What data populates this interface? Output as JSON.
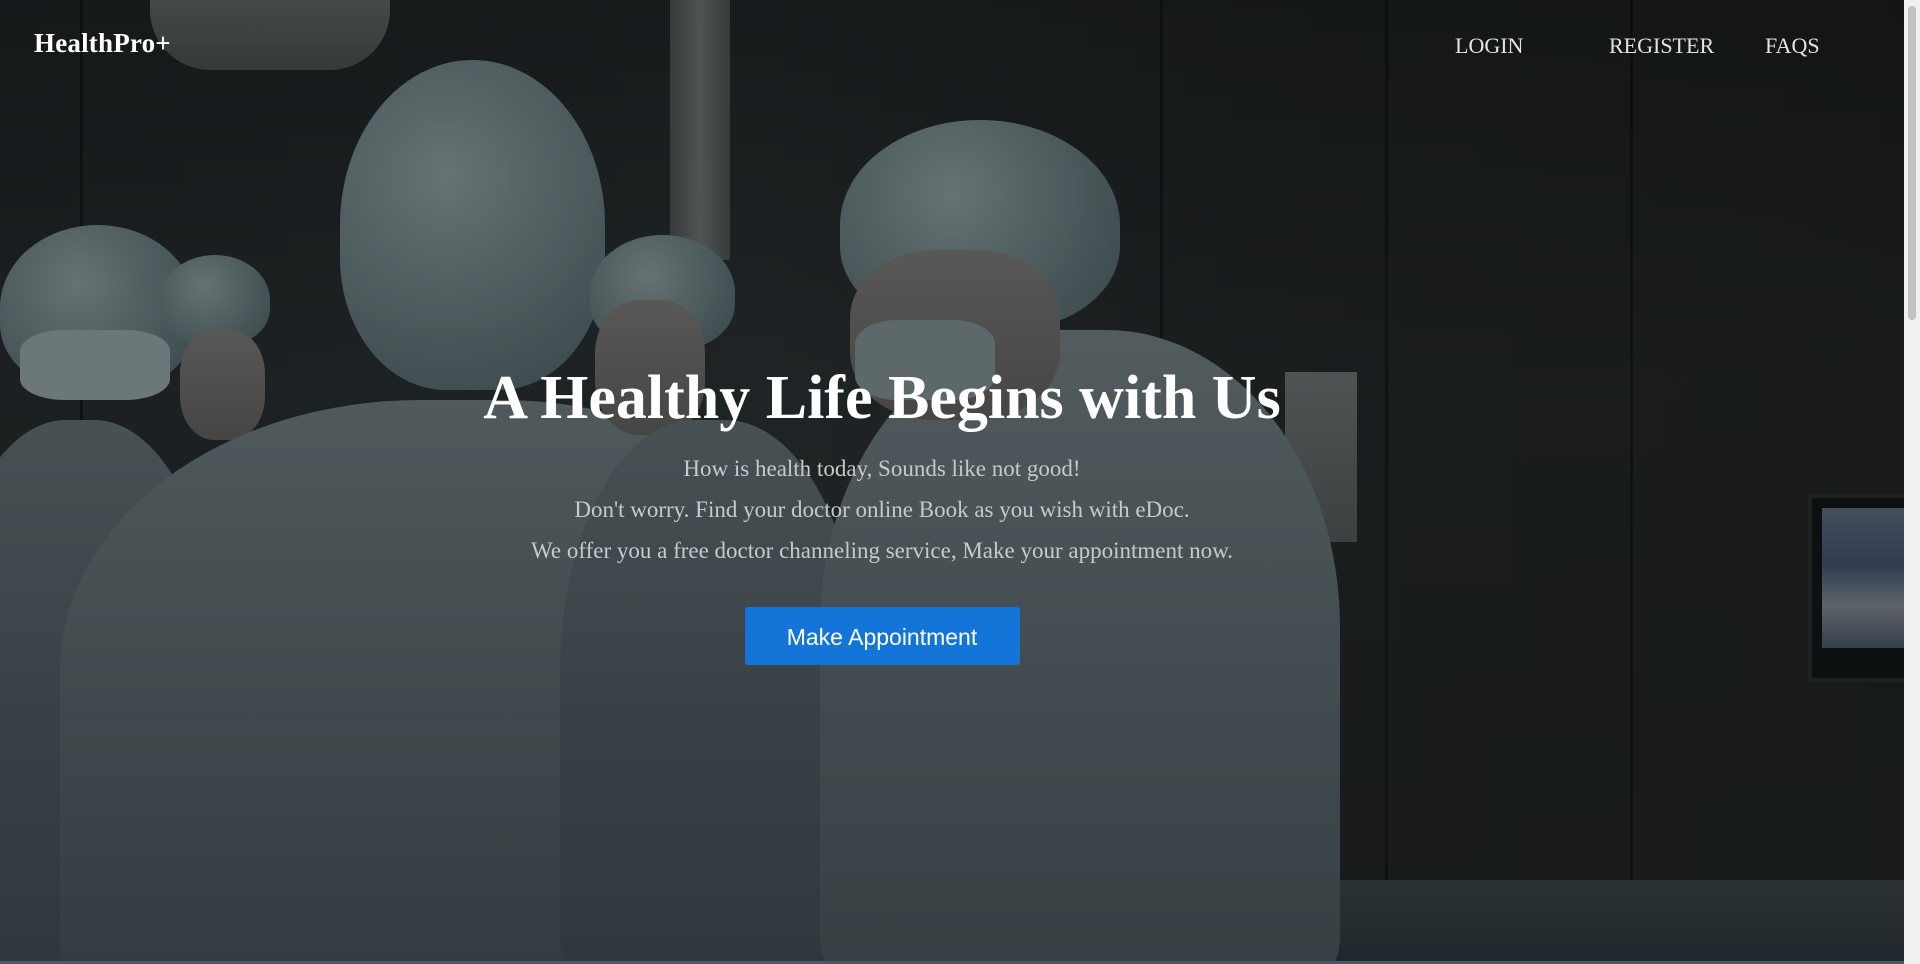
{
  "header": {
    "brand": "HealthPro+",
    "nav": {
      "login": "LOGIN",
      "register": "REGISTER",
      "faqs": "FAQS"
    }
  },
  "hero": {
    "title": "A Healthy Life Begins with Us",
    "subtitle_lines": [
      "How is health today, Sounds like not good!",
      "Don't worry. Find your doctor online Book as you wish with eDoc.",
      "We offer you a free doctor channeling service, Make your appointment now."
    ],
    "cta_label": "Make Appointment"
  },
  "colors": {
    "accent": "#1475d8",
    "title_text": "#ffffff",
    "body_text": "#c9c9c9",
    "nav_text": "#e3e3e3"
  }
}
